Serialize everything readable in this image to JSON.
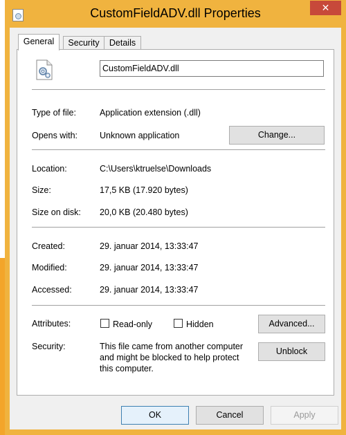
{
  "window": {
    "title": "CustomFieldADV.dll Properties",
    "close_glyph": "✕",
    "frame_color": "#f0b33f",
    "close_color": "#c7493a"
  },
  "tabs": [
    {
      "label": "General",
      "active": true
    },
    {
      "label": "Security",
      "active": false
    },
    {
      "label": "Details",
      "active": false
    }
  ],
  "file": {
    "name": "CustomFieldADV.dll",
    "icon": "dll-file-icon"
  },
  "info": {
    "type_label": "Type of file:",
    "type_value": "Application extension (.dll)",
    "opens_label": "Opens with:",
    "opens_value": "Unknown application",
    "change_button": "Change...",
    "location_label": "Location:",
    "location_value": "C:\\Users\\ktruelse\\Downloads",
    "size_label": "Size:",
    "size_value": "17,5 KB (17.920 bytes)",
    "disk_label": "Size on disk:",
    "disk_value": "20,0 KB (20.480 bytes)",
    "created_label": "Created:",
    "created_value": "29. januar 2014, 13:33:47",
    "modified_label": "Modified:",
    "modified_value": "29. januar 2014, 13:33:47",
    "accessed_label": "Accessed:",
    "accessed_value": "29. januar 2014, 13:33:47"
  },
  "attributes": {
    "label": "Attributes:",
    "readonly_label": "Read-only",
    "readonly_checked": false,
    "hidden_label": "Hidden",
    "hidden_checked": false,
    "advanced_button": "Advanced..."
  },
  "security": {
    "label": "Security:",
    "message_line1": "This file came from another computer",
    "message_line2": "and might be blocked to help protect",
    "message_line3": "this computer.",
    "unblock_button": "Unblock"
  },
  "footer": {
    "ok": "OK",
    "cancel": "Cancel",
    "apply": "Apply"
  }
}
